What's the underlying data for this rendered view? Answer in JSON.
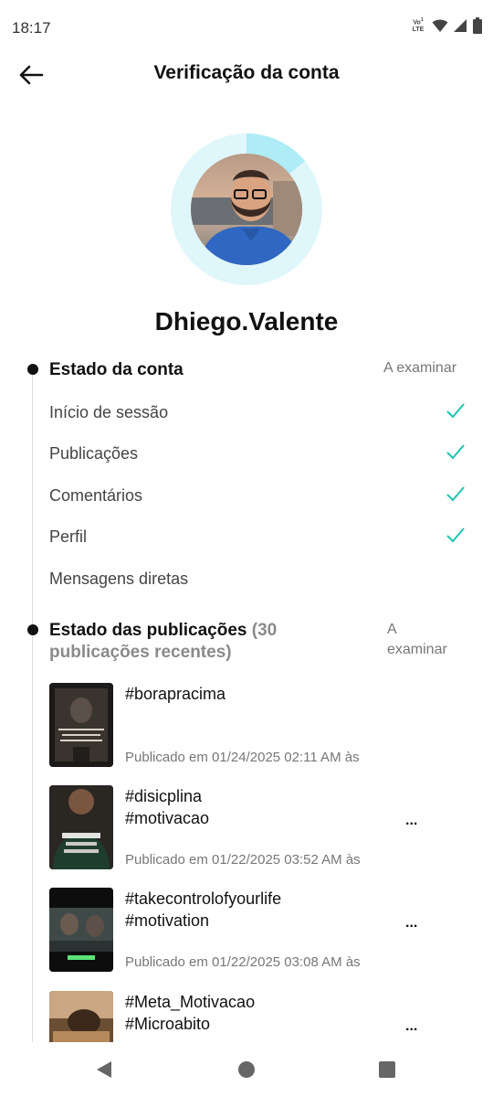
{
  "status_bar": {
    "time": "18:17",
    "volte_label": "Vo¹\nLTE",
    "icons": [
      "volte-icon",
      "wifi-icon",
      "signal-icon",
      "battery-icon"
    ]
  },
  "header": {
    "title": "Verificação da conta",
    "back_icon": "arrow-left-icon"
  },
  "profile": {
    "username": "Dhiego.Valente",
    "ring_color": "#dff6fb",
    "ring_accent": "#8fe3f0"
  },
  "account_status": {
    "title": "Estado da conta",
    "status": "A examinar",
    "checks": [
      {
        "label": "Início de sessão",
        "checked": true
      },
      {
        "label": "Publicações",
        "checked": true
      },
      {
        "label": "Comentários",
        "checked": true
      },
      {
        "label": "Perfil",
        "checked": true
      },
      {
        "label": "Mensagens diretas",
        "checked": false
      }
    ],
    "check_color": "#20c4b0"
  },
  "posts_status": {
    "title": "Estado das publicações",
    "subtitle": "(30 publicações recentes)",
    "status_line1": "A",
    "status_line2": "examinar",
    "posts": [
      {
        "caption_line1": "#borapracima",
        "caption_line2": "",
        "more": "",
        "date": "Publicado em 01/24/2025 02:11 AM às"
      },
      {
        "caption_line1": "#disicplina",
        "caption_line2": "#motivacao",
        "more": "...",
        "date": "Publicado em 01/22/2025 03:52 AM às"
      },
      {
        "caption_line1": "#takecontrolofyourlife",
        "caption_line2": "#motivation",
        "more": "...",
        "date": "Publicado em 01/22/2025 03:08 AM às"
      },
      {
        "caption_line1": "#Meta_Motivacao",
        "caption_line2": "#Microabito",
        "more": "...",
        "date": ""
      }
    ]
  },
  "nav_bar": {
    "icons": [
      "back-triangle-icon",
      "home-circle-icon",
      "recents-square-icon"
    ]
  }
}
